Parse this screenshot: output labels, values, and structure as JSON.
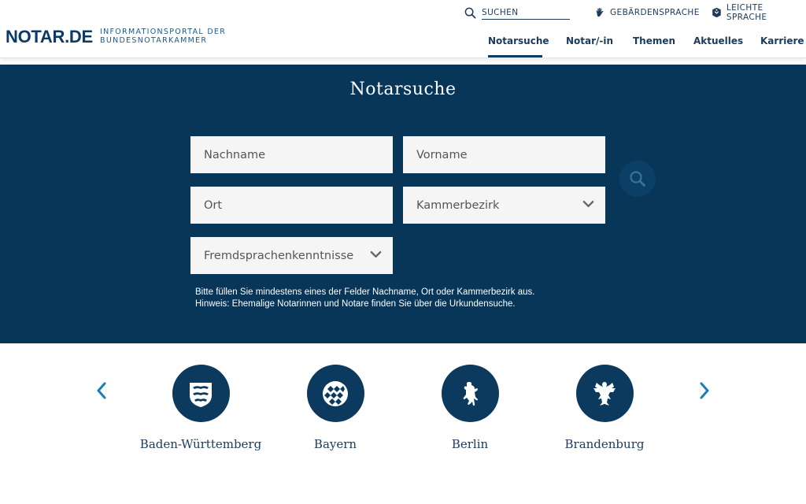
{
  "header": {
    "logo": "NOTAR.DE",
    "tagline_line1": "INFORMATIONSPORTAL DER",
    "tagline_line2": "BUNDESNOTARKAMMER",
    "search_placeholder": "SUCHEN",
    "sign_language": "GEBÄRDENSPRACHE",
    "easy_language": "LEICHTE SPRACHE",
    "nav": [
      {
        "label": "Notarsuche",
        "active": true
      },
      {
        "label": "Notar/-in"
      },
      {
        "label": "Themen"
      },
      {
        "label": "Aktuelles"
      },
      {
        "label": "Karriere"
      }
    ]
  },
  "search": {
    "title": "Notarsuche",
    "lastname_placeholder": "Nachname",
    "firstname_placeholder": "Vorname",
    "city_placeholder": "Ort",
    "chamber_select": "Kammerbezirk",
    "language_select": "Fremdsprachenkenntnisse",
    "hint_line1": "Bitte füllen Sie mindestens eines der Felder Nachname, Ort oder Kammerbezirk aus.",
    "hint_line2": "Hinweis: Ehemalige Notarinnen und Notare finden Sie über die Urkundensuche."
  },
  "states": [
    {
      "name": "Baden-Württemberg",
      "icon": "baden-wuerttemberg-crest-icon"
    },
    {
      "name": "Bayern",
      "icon": "bavaria-diamond-crest-icon"
    },
    {
      "name": "Berlin",
      "icon": "berlin-bear-icon"
    },
    {
      "name": "Brandenburg",
      "icon": "brandenburg-eagle-icon"
    }
  ],
  "colors": {
    "brand": "#0b3a66",
    "band": "#073659",
    "field": "#f5f5f5",
    "arrow": "#1b7fb3"
  }
}
